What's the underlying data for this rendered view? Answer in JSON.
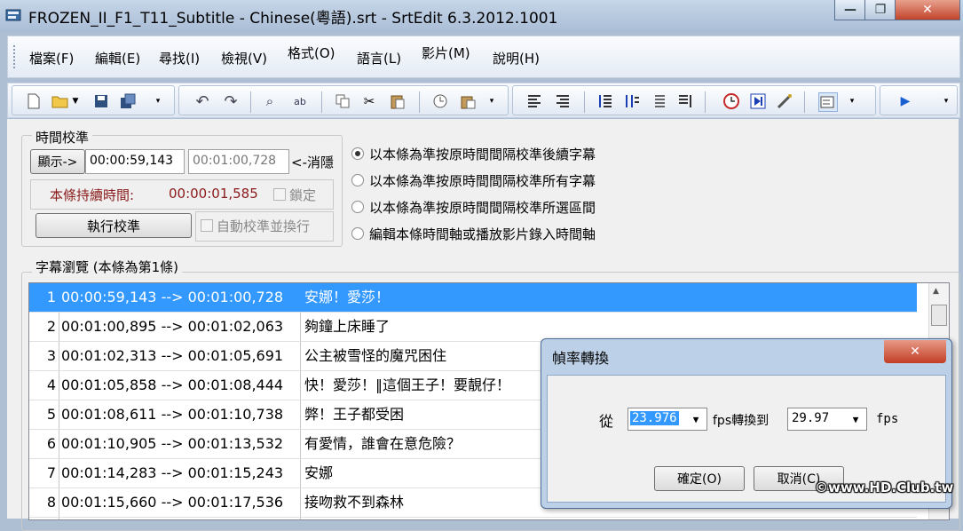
{
  "window": {
    "title": "FROZEN_II_F1_T11_Subtitle - Chinese(粵語).srt - SrtEdit 6.3.2012.1001",
    "minimize": "—",
    "maximize": "❐",
    "close": "✕"
  },
  "menu": [
    "檔案(F)",
    "編輯(E)",
    "尋找(I)",
    "檢視(V)",
    "格式(O)",
    "語言(L)",
    "影片(M)",
    "說明(H)"
  ],
  "timing": {
    "group_title": "時間校準",
    "show_button": "顯示->",
    "time_current": "00:00:59,143",
    "time_target": "00:01:00,728",
    "clear_button": "<-消隱",
    "duration_label": "本條持續時間:",
    "duration_value": "00:00:01,585",
    "lock_label": "鎖定",
    "execute_button": "執行校準",
    "auto_label": "自動校準並換行",
    "accent": "#8b1a1a"
  },
  "options": [
    "以本條為準按原時間間隔校準後續字幕",
    "以本條為準按原時間間隔校準所有字幕",
    "以本條為準按原時間間隔校準所選區間",
    "編輯本條時間軸或播放影片錄入時間軸"
  ],
  "subtitles": {
    "group_title": "字幕瀏覽 (本條為第1條)",
    "rows": [
      {
        "num": "1",
        "time": "00:00:59,143 --> 00:01:00,728",
        "text": "安娜！愛莎！"
      },
      {
        "num": "2",
        "time": "00:01:00,895 --> 00:01:02,063",
        "text": "夠鐘上床睡了"
      },
      {
        "num": "3",
        "time": "00:01:02,313 --> 00:01:05,691",
        "text": "公主被雪怪的魔咒困住"
      },
      {
        "num": "4",
        "time": "00:01:05,858 --> 00:01:08,444",
        "text": "快！愛莎！‖這個王子！要靚仔！"
      },
      {
        "num": "5",
        "time": "00:01:08,611 --> 00:01:10,738",
        "text": "弊！王子都受困"
      },
      {
        "num": "6",
        "time": "00:01:10,905 --> 00:01:13,532",
        "text": "有愛情，誰會在意危險？"
      },
      {
        "num": "7",
        "time": "00:01:14,283 --> 00:01:15,243",
        "text": "安娜"
      },
      {
        "num": "8",
        "time": "00:01:15,660 --> 00:01:17,536",
        "text": "接吻救不到森林"
      }
    ],
    "selected_color": "#3399ff"
  },
  "dialog": {
    "title": "幀率轉換",
    "from_label": "從",
    "from_value": "23.976",
    "middle_label": "fps轉換到",
    "to_value": "29.97",
    "fps_label": "fps",
    "ok_button": "確定(O)",
    "cancel_button": "取消(C)",
    "close_icon": "✕"
  },
  "watermark": "©www.HD.Club.tw"
}
